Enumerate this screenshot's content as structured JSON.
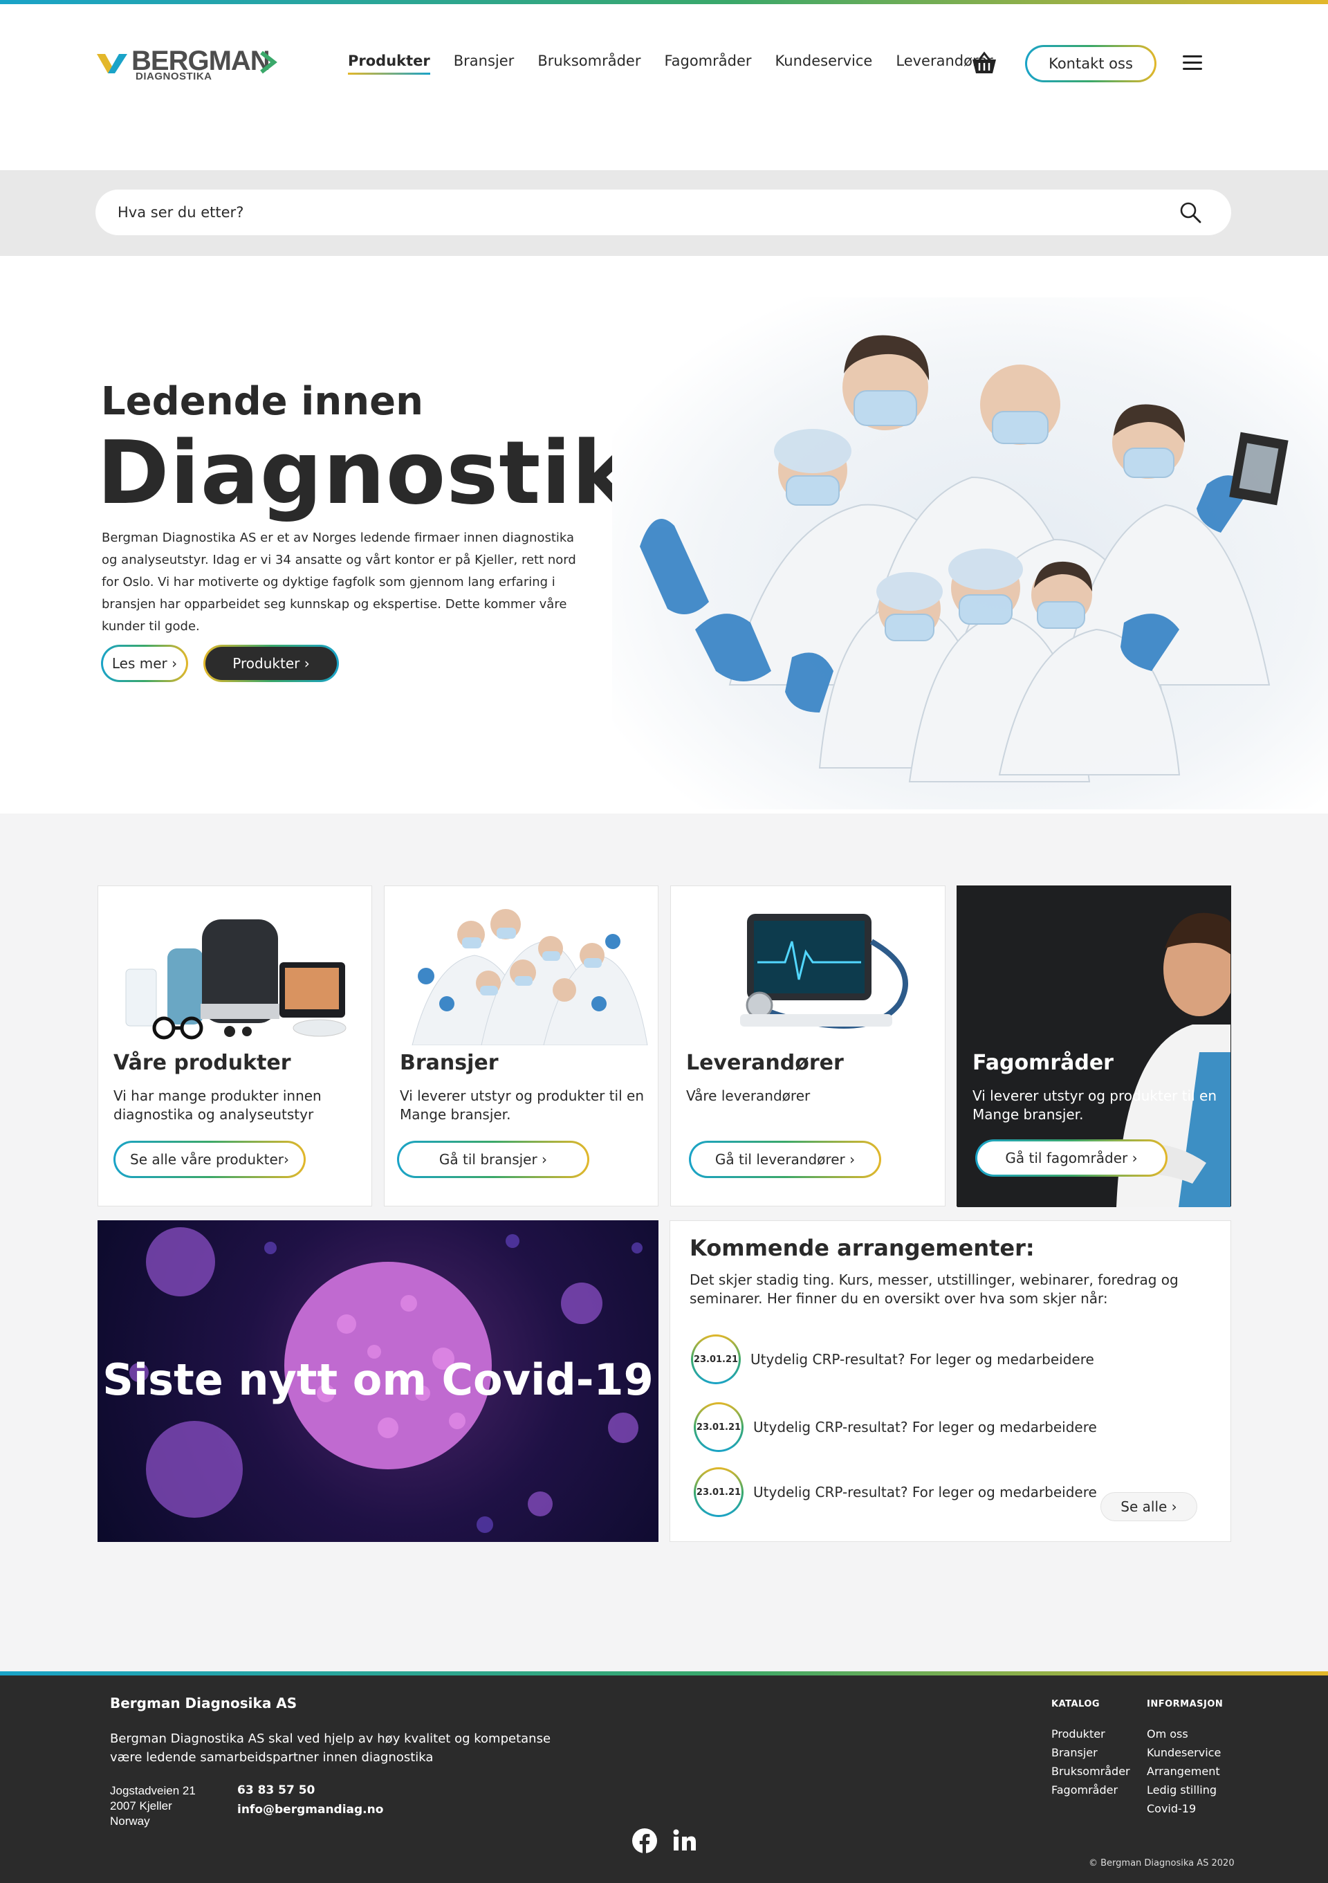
{
  "header": {
    "logo_text": "BERGMAN",
    "logo_sub": "DIAGNOSTIKA",
    "nav": [
      "Produkter",
      "Bransjer",
      "Bruksområder",
      "Fagområder",
      "Kundeservice",
      "Leverandører"
    ],
    "contact_label": "Kontakt oss"
  },
  "search": {
    "placeholder": "Hva ser du etter?"
  },
  "hero": {
    "subtitle": "Ledende innen",
    "title": "Diagnostikk",
    "text": "Bergman Diagnostika AS er et av Norges ledende firmaer innen diagnostika og analyseutstyr. Idag er vi 34 ansatte og vårt kontor er på Kjeller, rett nord for Oslo. Vi har motiverte og dyktige fagfolk som gjennom lang erfaring i bransjen har opparbeidet seg kunnskap og ekspertise. Dette kommer våre kunder til gode.",
    "btn_more": "Les mer ›",
    "btn_products": "Produkter ›"
  },
  "cards": [
    {
      "title": "Våre produkter",
      "text": "Vi har mange produkter innen diagnostika og analyseutstyr",
      "button": "Se alle våre produkter›"
    },
    {
      "title": "Bransjer",
      "text": "Vi leverer utstyr og produkter til en Mange bransjer.",
      "button": "Gå til bransjer     ›"
    },
    {
      "title": "Leverandører",
      "text": "Våre leverandører",
      "button": "Gå til leverandører   ›"
    },
    {
      "title": "Fagområder",
      "text": "Vi leverer utstyr og produkter til en Mange bransjer.",
      "button": "Gå til fagområder   ›"
    }
  ],
  "covid": {
    "title": "Siste nytt om Covid-19"
  },
  "events": {
    "title": "Kommende arrangementer:",
    "intro": "Det skjer stadig ting. Kurs, messer, utstillinger, webinarer, foredrag og seminarer. Her finner du en oversikt over hva som skjer når:",
    "items": [
      {
        "date": "23.01.21",
        "text": "Utydelig CRP-resultat?  For leger og medarbeidere"
      },
      {
        "date": "23.01.21",
        "text": "Utydelig CRP-resultat?  For leger og medarbeidere"
      },
      {
        "date": "23.01.21",
        "text": "Utydelig CRP-resultat?  For leger og medarbeidere"
      }
    ],
    "see_all": "Se alle    ›"
  },
  "footer": {
    "company": "Bergman Diagnosika AS",
    "desc": "Bergman Diagnostika AS skal ved hjelp av høy kvalitet og kompetanse være ledende samarbeidspartner innen diagnostika",
    "address": [
      "Jogstadveien 21",
      "2007 Kjeller",
      "Norway"
    ],
    "phone": "63 83 57 50",
    "email": "info@bergmandiag.no",
    "catalog_title": "KATALOG",
    "catalog": [
      "Produkter",
      "Bransjer",
      "Bruksområder",
      "Fagområder"
    ],
    "info_title": "INFORMASJON",
    "info": [
      "Om oss",
      "Kundeservice",
      "Arrangement",
      "Ledig stilling",
      "Covid-19"
    ],
    "copyright": "© Bergman Diagnosika AS 2020"
  },
  "colors": {
    "teal": "#1aa3c8",
    "green": "#3aa86a",
    "yellow": "#e3b72a",
    "dark": "#2b2b2b"
  }
}
